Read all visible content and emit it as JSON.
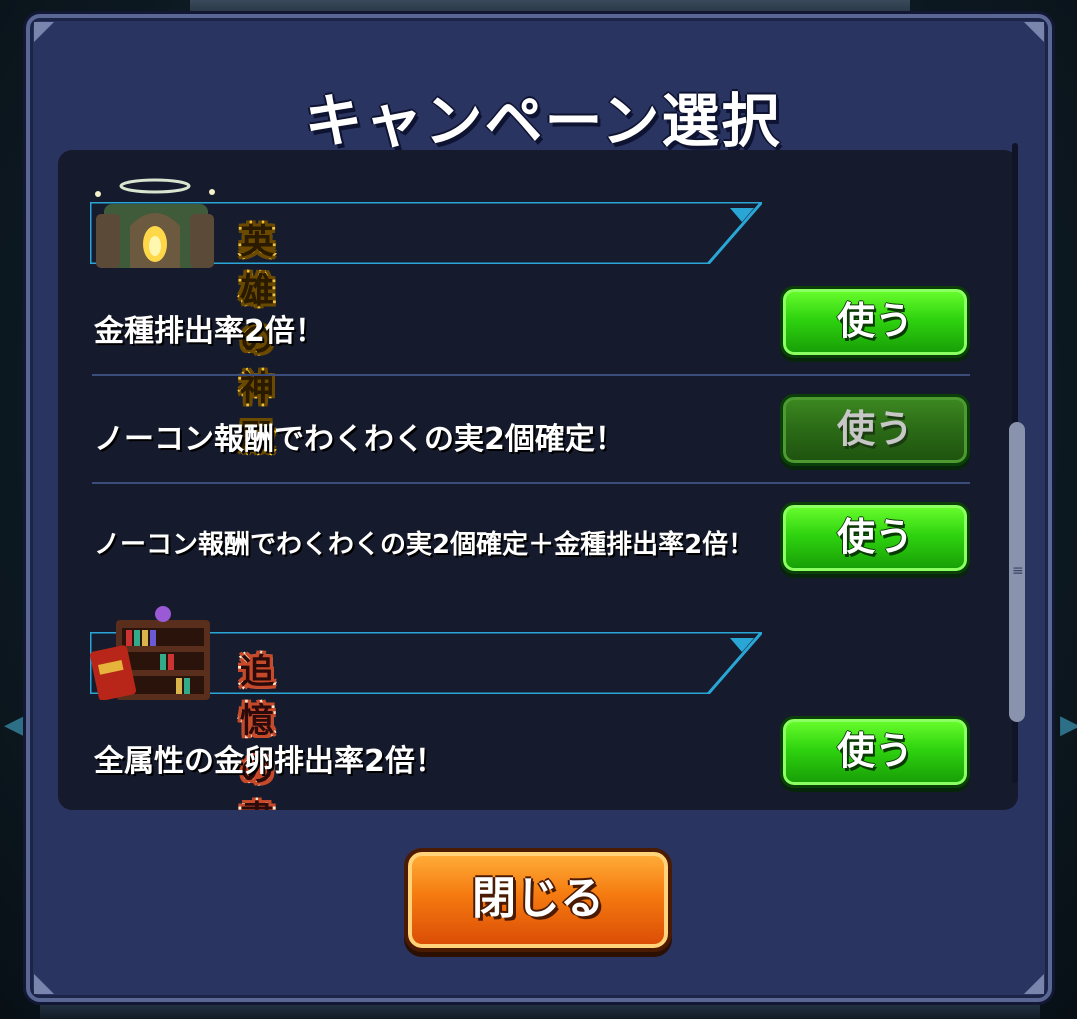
{
  "dialog": {
    "title": "キャンペーン選択",
    "close_label": "閉じる"
  },
  "sections": [
    {
      "name": "英雄の神殿",
      "icon": "temple-icon",
      "items": [
        {
          "text": "金種排出率2倍！",
          "button": "使う",
          "enabled": true
        },
        {
          "text": "ノーコン報酬でわくわくの実2個確定！",
          "button": "使う",
          "enabled": false
        },
        {
          "text": "ノーコン報酬でわくわくの実2個確定＋金種排出率2倍！",
          "button": "使う",
          "enabled": true
        }
      ]
    },
    {
      "name": "追憶の書庫",
      "icon": "bookshelf-icon",
      "items": [
        {
          "text": "全属性の金卵排出率2倍！",
          "button": "使う",
          "enabled": true
        }
      ]
    }
  ],
  "colors": {
    "dialog_bg": "#2a3461",
    "panel_bg": "#151a2c",
    "use_button": "#2fd40f",
    "close_button": "#f57a10",
    "banner_edge": "#2aa6d6"
  }
}
